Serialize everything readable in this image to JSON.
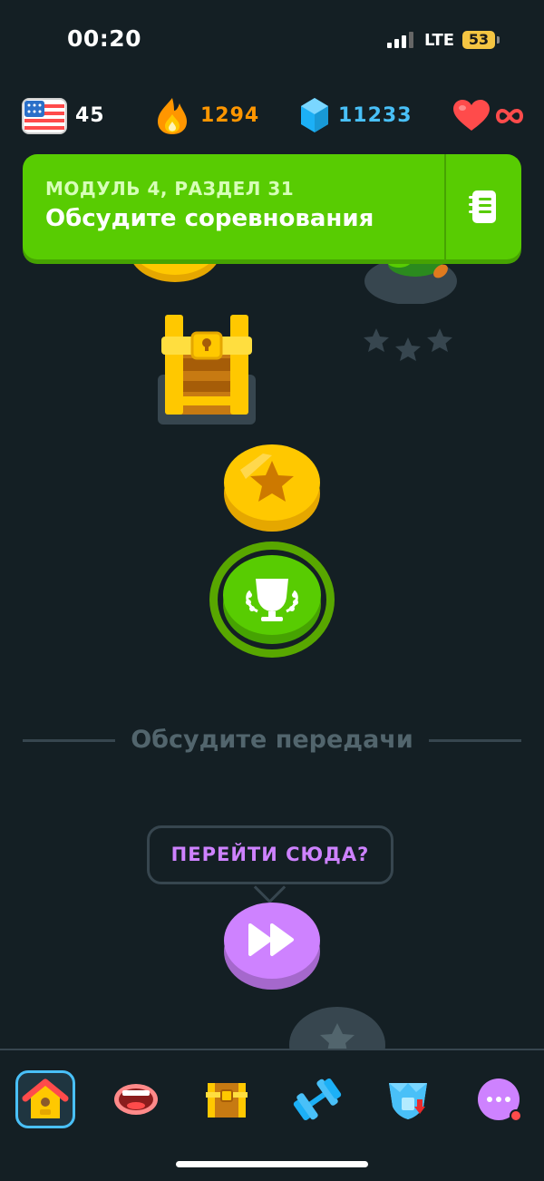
{
  "status_bar": {
    "time": "00:20",
    "network": "LTE",
    "battery": "53"
  },
  "stats": {
    "course_flag_icon": "us-flag-icon",
    "course_level": "45",
    "streak": "1294",
    "gems": "11233",
    "hearts_icon": "infinity-icon"
  },
  "banner": {
    "subtitle": "МОДУЛЬ 4, РАЗДЕЛ 31",
    "title": "Обсудите соревнования",
    "guide_icon": "notebook-icon"
  },
  "path": {
    "section_title": "Обсудите передачи",
    "jump_tooltip": "ПЕРЕЙТИ СЮДА?"
  },
  "bottom_nav": [
    {
      "icon": "home-icon",
      "active": true
    },
    {
      "icon": "speaking-mouth-icon",
      "active": false
    },
    {
      "icon": "treasure-chest-icon",
      "active": false
    },
    {
      "icon": "dumbbell-icon",
      "active": false
    },
    {
      "icon": "shield-league-icon",
      "active": false
    },
    {
      "icon": "more-icon",
      "active": false
    }
  ],
  "colors": {
    "background": "#141f24",
    "banner": "#58cc02",
    "streak": "#ff9600",
    "gems": "#49c0f8",
    "hearts": "#ff4b4b",
    "tooltip_text": "#ce82ff",
    "jump_button": "#ce82ff"
  }
}
